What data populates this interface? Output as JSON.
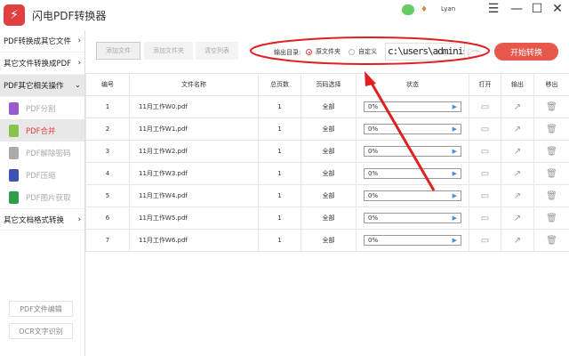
{
  "app": {
    "title": "闪电PDF转换器",
    "user": "Lyan",
    "logo_icon": "lightning-icon"
  },
  "sidebar": {
    "groups": [
      {
        "label": "PDF转换成其它文件"
      },
      {
        "label": "其它文件转换成PDF"
      },
      {
        "label": "PDF其它相关操作"
      }
    ],
    "items": [
      {
        "label": "PDF分割",
        "color": "#9b59d0"
      },
      {
        "label": "PDF合并",
        "color": "#8bc34a"
      },
      {
        "label": "PDF解除密码",
        "color": "#aaaaaa"
      },
      {
        "label": "PDF压缩",
        "color": "#3f51b5"
      },
      {
        "label": "PDF图片获取",
        "color": "#2e9e4a"
      }
    ],
    "last_group": "其它文档格式转换",
    "buttons": [
      "PDF文件编辑",
      "OCR文字识别"
    ]
  },
  "toolbar": {
    "add_file": "添加文件",
    "add_folder": "添加文件夹",
    "clear_list": "清空列表",
    "output_label": "输出目录:",
    "opt_source": "原文件夹",
    "opt_custom": "自定义",
    "path": "c:\\users\\administ",
    "start": "开始转换",
    "accent": "#e8574b"
  },
  "table": {
    "headers": [
      "编号",
      "文件名称",
      "总页数",
      "页码选择",
      "状态",
      "打开",
      "输出",
      "移出"
    ],
    "rows": [
      {
        "no": "1",
        "name": "11月工作W0.pdf",
        "pages": "1",
        "range": "全部",
        "status": "0%"
      },
      {
        "no": "2",
        "name": "11月工作W1.pdf",
        "pages": "1",
        "range": "全部",
        "status": "0%"
      },
      {
        "no": "3",
        "name": "11月工作W2.pdf",
        "pages": "1",
        "range": "全部",
        "status": "0%"
      },
      {
        "no": "4",
        "name": "11月工作W3.pdf",
        "pages": "1",
        "range": "全部",
        "status": "0%"
      },
      {
        "no": "5",
        "name": "11月工作W4.pdf",
        "pages": "1",
        "range": "全部",
        "status": "0%"
      },
      {
        "no": "6",
        "name": "11月工作W5.pdf",
        "pages": "1",
        "range": "全部",
        "status": "0%"
      },
      {
        "no": "7",
        "name": "11月工作W6.pdf",
        "pages": "1",
        "range": "全部",
        "status": "0%"
      }
    ]
  }
}
